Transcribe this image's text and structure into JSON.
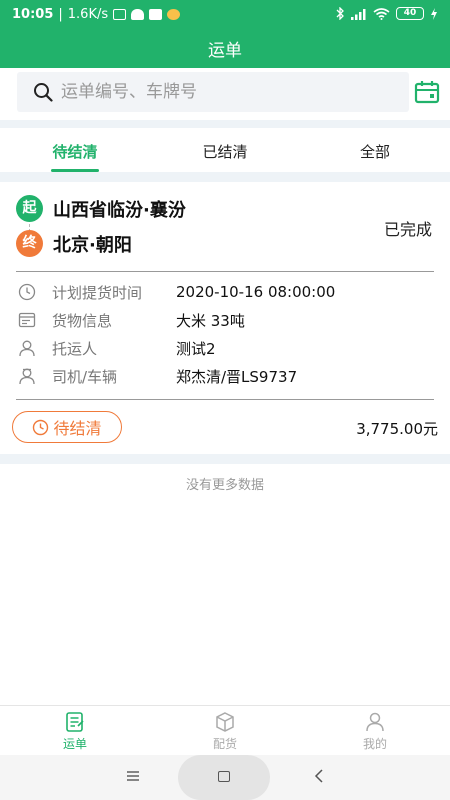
{
  "status_bar": {
    "time": "10:05",
    "network_speed": "1.6K/s",
    "battery": "40"
  },
  "header": {
    "title": "运单"
  },
  "search": {
    "placeholder": "运单编号、车牌号"
  },
  "tabs": [
    {
      "label": "待结清",
      "active": true
    },
    {
      "label": "已结清",
      "active": false
    },
    {
      "label": "全部",
      "active": false
    }
  ],
  "order": {
    "from_badge": "起",
    "from_place": "山西省临汾·襄汾",
    "to_badge": "终",
    "to_place": "北京·朝阳",
    "status": "已完成",
    "details": [
      {
        "icon": "clock-icon",
        "label": "计划提货时间",
        "value": "2020-10-16 08:00:00"
      },
      {
        "icon": "cargo-icon",
        "label": "货物信息",
        "value": "大米 33吨"
      },
      {
        "icon": "person-icon",
        "label": "托运人",
        "value": "测试2"
      },
      {
        "icon": "driver-icon",
        "label": "司机/车辆",
        "value": "郑杰清/晋LS9737"
      }
    ],
    "settle_button": "待结清",
    "amount": "3,775.00元"
  },
  "no_more_text": "没有更多数据",
  "bottom_nav": [
    {
      "label": "运单",
      "icon": "waybill-icon",
      "active": true
    },
    {
      "label": "配货",
      "icon": "box-icon",
      "active": false
    },
    {
      "label": "我的",
      "icon": "user-icon",
      "active": false
    }
  ],
  "colors": {
    "primary": "#21b26b",
    "accent": "#f07a3a",
    "background_gap": "#eef3f7"
  }
}
